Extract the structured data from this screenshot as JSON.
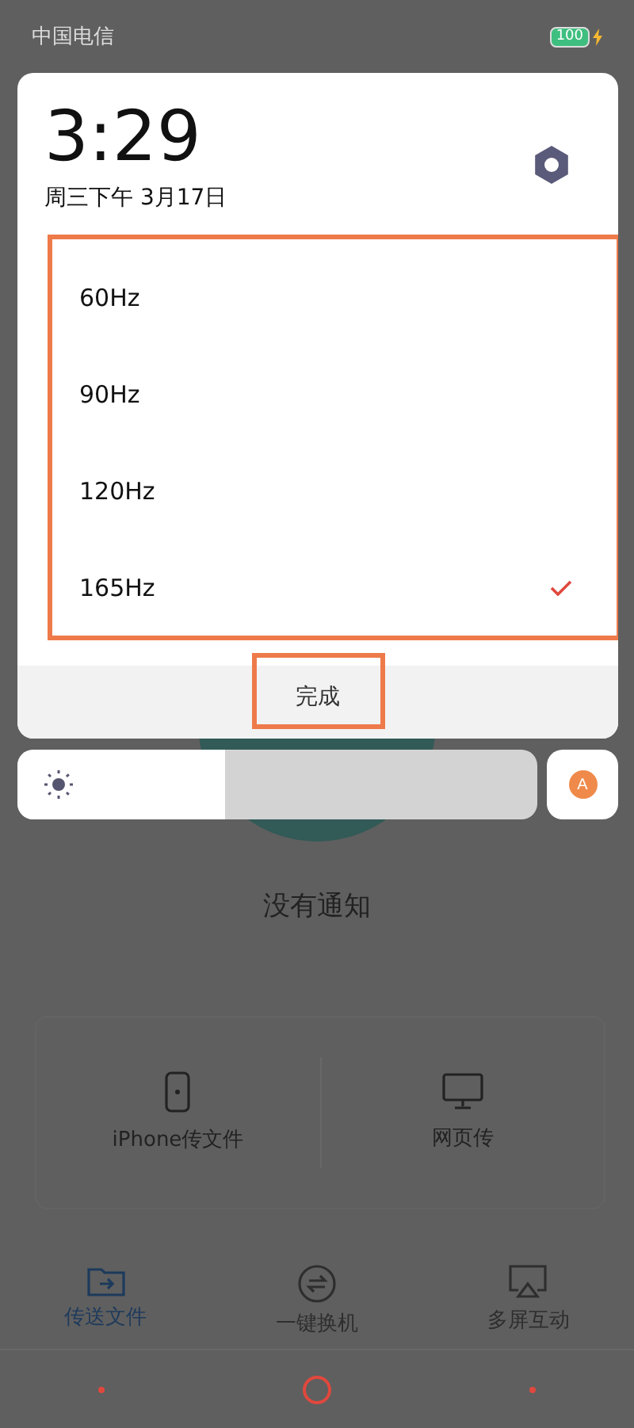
{
  "status_bar": {
    "carrier": "中国电信",
    "battery": "100",
    "charging": true
  },
  "panel": {
    "time": "3:29",
    "date": "周三下午 3月17日"
  },
  "refresh_rates": [
    {
      "label": "60Hz",
      "selected": false
    },
    {
      "label": "90Hz",
      "selected": false
    },
    {
      "label": "120Hz",
      "selected": false
    },
    {
      "label": "165Hz",
      "selected": true
    }
  ],
  "done_button": "完成",
  "brightness": {
    "level": 0.4,
    "auto": "A"
  },
  "background": {
    "message": "没有通知",
    "options": [
      {
        "label": "iPhone传文件",
        "kind": "phone"
      },
      {
        "label": "网页传",
        "kind": "monitor"
      }
    ],
    "tabs": [
      {
        "label": "传送文件",
        "kind": "folder",
        "selected": true
      },
      {
        "label": "一键换机",
        "kind": "swap",
        "selected": false
      },
      {
        "label": "多屏互动",
        "kind": "cast",
        "selected": false
      }
    ]
  }
}
